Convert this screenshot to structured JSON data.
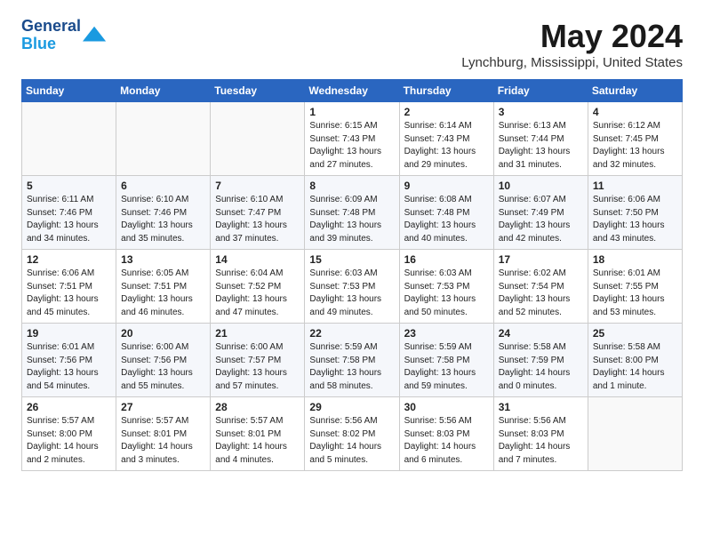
{
  "header": {
    "logo_line1": "General",
    "logo_line2": "Blue",
    "month_title": "May 2024",
    "location": "Lynchburg, Mississippi, United States"
  },
  "weekdays": [
    "Sunday",
    "Monday",
    "Tuesday",
    "Wednesday",
    "Thursday",
    "Friday",
    "Saturday"
  ],
  "weeks": [
    [
      {
        "day": "",
        "text": ""
      },
      {
        "day": "",
        "text": ""
      },
      {
        "day": "",
        "text": ""
      },
      {
        "day": "1",
        "text": "Sunrise: 6:15 AM\nSunset: 7:43 PM\nDaylight: 13 hours\nand 27 minutes."
      },
      {
        "day": "2",
        "text": "Sunrise: 6:14 AM\nSunset: 7:43 PM\nDaylight: 13 hours\nand 29 minutes."
      },
      {
        "day": "3",
        "text": "Sunrise: 6:13 AM\nSunset: 7:44 PM\nDaylight: 13 hours\nand 31 minutes."
      },
      {
        "day": "4",
        "text": "Sunrise: 6:12 AM\nSunset: 7:45 PM\nDaylight: 13 hours\nand 32 minutes."
      }
    ],
    [
      {
        "day": "5",
        "text": "Sunrise: 6:11 AM\nSunset: 7:46 PM\nDaylight: 13 hours\nand 34 minutes."
      },
      {
        "day": "6",
        "text": "Sunrise: 6:10 AM\nSunset: 7:46 PM\nDaylight: 13 hours\nand 35 minutes."
      },
      {
        "day": "7",
        "text": "Sunrise: 6:10 AM\nSunset: 7:47 PM\nDaylight: 13 hours\nand 37 minutes."
      },
      {
        "day": "8",
        "text": "Sunrise: 6:09 AM\nSunset: 7:48 PM\nDaylight: 13 hours\nand 39 minutes."
      },
      {
        "day": "9",
        "text": "Sunrise: 6:08 AM\nSunset: 7:48 PM\nDaylight: 13 hours\nand 40 minutes."
      },
      {
        "day": "10",
        "text": "Sunrise: 6:07 AM\nSunset: 7:49 PM\nDaylight: 13 hours\nand 42 minutes."
      },
      {
        "day": "11",
        "text": "Sunrise: 6:06 AM\nSunset: 7:50 PM\nDaylight: 13 hours\nand 43 minutes."
      }
    ],
    [
      {
        "day": "12",
        "text": "Sunrise: 6:06 AM\nSunset: 7:51 PM\nDaylight: 13 hours\nand 45 minutes."
      },
      {
        "day": "13",
        "text": "Sunrise: 6:05 AM\nSunset: 7:51 PM\nDaylight: 13 hours\nand 46 minutes."
      },
      {
        "day": "14",
        "text": "Sunrise: 6:04 AM\nSunset: 7:52 PM\nDaylight: 13 hours\nand 47 minutes."
      },
      {
        "day": "15",
        "text": "Sunrise: 6:03 AM\nSunset: 7:53 PM\nDaylight: 13 hours\nand 49 minutes."
      },
      {
        "day": "16",
        "text": "Sunrise: 6:03 AM\nSunset: 7:53 PM\nDaylight: 13 hours\nand 50 minutes."
      },
      {
        "day": "17",
        "text": "Sunrise: 6:02 AM\nSunset: 7:54 PM\nDaylight: 13 hours\nand 52 minutes."
      },
      {
        "day": "18",
        "text": "Sunrise: 6:01 AM\nSunset: 7:55 PM\nDaylight: 13 hours\nand 53 minutes."
      }
    ],
    [
      {
        "day": "19",
        "text": "Sunrise: 6:01 AM\nSunset: 7:56 PM\nDaylight: 13 hours\nand 54 minutes."
      },
      {
        "day": "20",
        "text": "Sunrise: 6:00 AM\nSunset: 7:56 PM\nDaylight: 13 hours\nand 55 minutes."
      },
      {
        "day": "21",
        "text": "Sunrise: 6:00 AM\nSunset: 7:57 PM\nDaylight: 13 hours\nand 57 minutes."
      },
      {
        "day": "22",
        "text": "Sunrise: 5:59 AM\nSunset: 7:58 PM\nDaylight: 13 hours\nand 58 minutes."
      },
      {
        "day": "23",
        "text": "Sunrise: 5:59 AM\nSunset: 7:58 PM\nDaylight: 13 hours\nand 59 minutes."
      },
      {
        "day": "24",
        "text": "Sunrise: 5:58 AM\nSunset: 7:59 PM\nDaylight: 14 hours\nand 0 minutes."
      },
      {
        "day": "25",
        "text": "Sunrise: 5:58 AM\nSunset: 8:00 PM\nDaylight: 14 hours\nand 1 minute."
      }
    ],
    [
      {
        "day": "26",
        "text": "Sunrise: 5:57 AM\nSunset: 8:00 PM\nDaylight: 14 hours\nand 2 minutes."
      },
      {
        "day": "27",
        "text": "Sunrise: 5:57 AM\nSunset: 8:01 PM\nDaylight: 14 hours\nand 3 minutes."
      },
      {
        "day": "28",
        "text": "Sunrise: 5:57 AM\nSunset: 8:01 PM\nDaylight: 14 hours\nand 4 minutes."
      },
      {
        "day": "29",
        "text": "Sunrise: 5:56 AM\nSunset: 8:02 PM\nDaylight: 14 hours\nand 5 minutes."
      },
      {
        "day": "30",
        "text": "Sunrise: 5:56 AM\nSunset: 8:03 PM\nDaylight: 14 hours\nand 6 minutes."
      },
      {
        "day": "31",
        "text": "Sunrise: 5:56 AM\nSunset: 8:03 PM\nDaylight: 14 hours\nand 7 minutes."
      },
      {
        "day": "",
        "text": ""
      }
    ]
  ]
}
